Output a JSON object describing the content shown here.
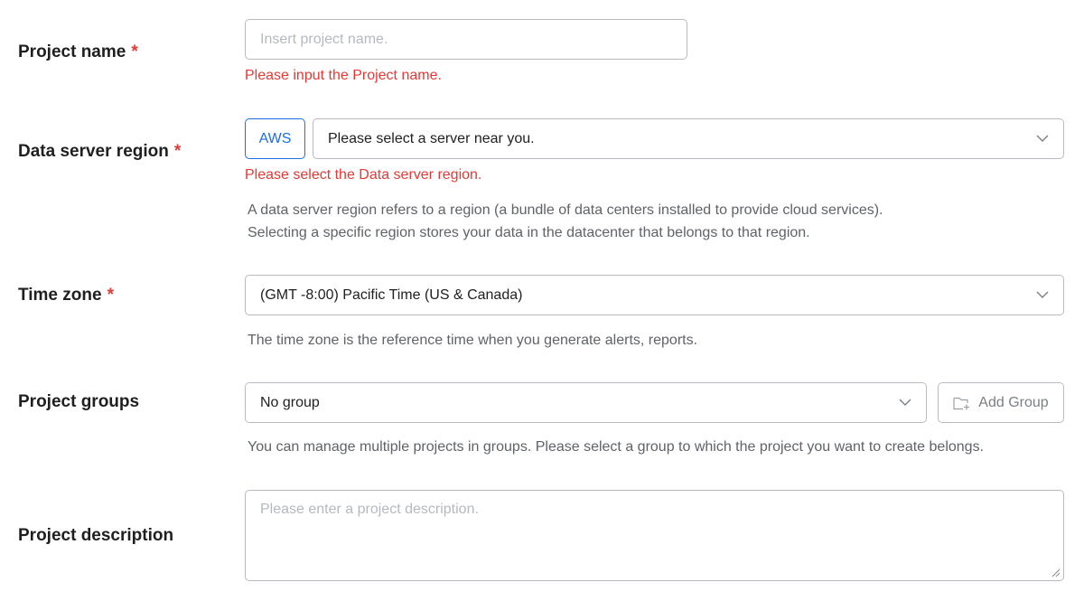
{
  "project_name": {
    "label": "Project name",
    "required_mark": "*",
    "placeholder": "Insert project name.",
    "error": "Please input the Project name."
  },
  "data_server_region": {
    "label": "Data server region",
    "required_mark": "*",
    "provider_button": "AWS",
    "selected": "Please select a server near you.",
    "error": "Please select the Data server region.",
    "help_line1": "A data server region refers to a region (a bundle of data centers installed to provide cloud services).",
    "help_line2": "Selecting a specific region stores your data in the datacenter that belongs to that region."
  },
  "time_zone": {
    "label": "Time zone",
    "required_mark": "*",
    "selected": "(GMT -8:00) Pacific Time (US & Canada)",
    "help": "The time zone is the reference time when you generate alerts, reports."
  },
  "project_groups": {
    "label": "Project groups",
    "selected": "No group",
    "add_button": "Add Group",
    "help": "You can manage multiple projects in groups. Please select a group to which the project you want to create belongs."
  },
  "project_description": {
    "label": "Project description",
    "placeholder": "Please enter a project description."
  },
  "icons": {
    "dropdown": "chevron-down-icon",
    "add_group": "folder-plus-icon",
    "resize": "resize-handle-icon"
  },
  "colors": {
    "error": "#e53935",
    "accent": "#1e6ee5",
    "border": "#b8bcc2",
    "help_text": "#5f6368"
  }
}
